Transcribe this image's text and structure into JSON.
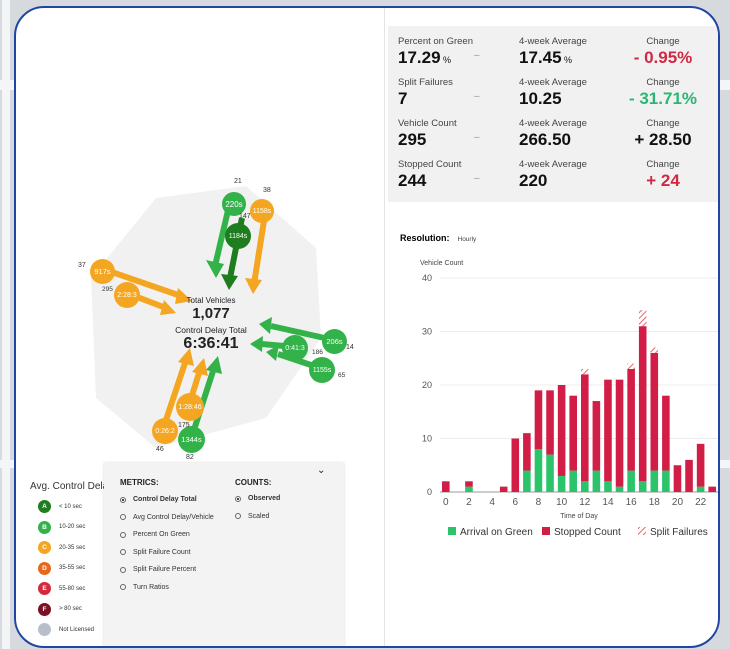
{
  "stats": [
    {
      "label": "Percent on Green",
      "value": "17.29",
      "unit": "%",
      "avg_label": "4-week Average",
      "avg_value": "17.45",
      "avg_unit": "%",
      "change_label": "Change",
      "change_value": "- 0.95%",
      "change_color": "#d02944"
    },
    {
      "label": "Split Failures",
      "value": "7",
      "unit": "",
      "avg_label": "4-week Average",
      "avg_value": "10.25",
      "avg_unit": "",
      "change_label": "Change",
      "change_value": "- 31.71%",
      "change_color": "#2bb673"
    },
    {
      "label": "Vehicle Count",
      "value": "295",
      "unit": "",
      "avg_label": "4-week Average",
      "avg_value": "266.50",
      "avg_unit": "",
      "change_label": "Change",
      "change_value": "+ 28.50",
      "change_color": "#111111"
    },
    {
      "label": "Stopped Count",
      "value": "244",
      "unit": "",
      "avg_label": "4-week Average",
      "avg_value": "220",
      "avg_unit": "",
      "change_label": "Change",
      "change_value": "+ 24",
      "change_color": "#d02944"
    }
  ],
  "dash_symbol": "–",
  "resolution": {
    "label": "Resolution:",
    "value": "Hourly"
  },
  "intersection": {
    "total_vehicles_label": "Total Vehicles",
    "total_vehicles": "1,077",
    "control_delay_label": "Control Delay Total",
    "control_delay": "6:36:41",
    "north": {
      "count_left": "21",
      "count_right": "38",
      "count_mid": "147",
      "delay_left": "220s",
      "delay_right": "1158s",
      "delay_mid": "1184s"
    },
    "west": {
      "count_top": "37",
      "count_bottom": "295",
      "delay_top": "917s",
      "delay_bottom": "2:28:3"
    },
    "east": {
      "count_top": "14",
      "count_mid": "186",
      "count_bottom": "65",
      "delay_top": "206s",
      "delay_mid": "0:41:3",
      "delay_bottom": "1155s"
    },
    "south": {
      "count_top": "175",
      "count_left": "46",
      "count_bottom": "82",
      "delay_top": "1:28:46",
      "delay_left": "0:26:2",
      "delay_bottom": "1344s"
    }
  },
  "metrics_panel": {
    "metrics_heading": "METRICS:",
    "counts_heading": "COUNTS:",
    "metrics": [
      "Control Delay Total",
      "Avg Control Delay/Vehicle",
      "Percent On Green",
      "Split Failure Count",
      "Split Failure Percent",
      "Turn Ratios"
    ],
    "metrics_selected": 0,
    "counts": [
      "Observed",
      "Scaled"
    ],
    "counts_selected": 0,
    "collapse_symbol": "⌄"
  },
  "avg_legend": {
    "title": "Avg. Control Dela",
    "items": [
      {
        "grade": "A",
        "label": "< 10 sec",
        "color": "#1e7d1e"
      },
      {
        "grade": "B",
        "label": "10-20 sec",
        "color": "#34b24a"
      },
      {
        "grade": "C",
        "label": "20-35 sec",
        "color": "#f4a622"
      },
      {
        "grade": "D",
        "label": "35-55 sec",
        "color": "#e8671f"
      },
      {
        "grade": "E",
        "label": "55-80 sec",
        "color": "#d4293d"
      },
      {
        "grade": "F",
        "label": "> 80 sec",
        "color": "#7d1024"
      },
      {
        "grade": "",
        "label": "Not Licensed",
        "color": "#b8bfca"
      }
    ]
  },
  "chart_data": {
    "type": "bar",
    "ylabel": "Vehicle Count",
    "xlabel": "Time of Day",
    "ylim": [
      0,
      40
    ],
    "yticks": [
      0,
      10,
      20,
      30,
      40
    ],
    "xticks": [
      0,
      2,
      4,
      6,
      8,
      10,
      12,
      14,
      16,
      18,
      20,
      22
    ],
    "categories": [
      0,
      1,
      2,
      3,
      4,
      5,
      6,
      7,
      8,
      9,
      10,
      11,
      12,
      13,
      14,
      15,
      16,
      17,
      18,
      19,
      20,
      21,
      22,
      23
    ],
    "series": [
      {
        "name": "Arrival on Green",
        "color": "#2bc46a",
        "values": [
          0,
          0,
          1,
          0,
          0,
          0,
          0,
          4,
          8,
          7,
          3,
          4,
          2,
          4,
          2,
          1,
          4,
          2,
          4,
          4,
          0,
          0,
          1,
          0
        ]
      },
      {
        "name": "Stopped Count",
        "color": "#d21d47",
        "values": [
          2,
          0,
          1,
          0,
          0,
          1,
          10,
          7,
          11,
          12,
          17,
          14,
          20,
          13,
          19,
          20,
          19,
          29,
          22,
          14,
          5,
          6,
          8,
          1
        ]
      },
      {
        "name": "Split Failures",
        "color": "#e8646e",
        "values": [
          0,
          0,
          0,
          0,
          0,
          0,
          0,
          0,
          0,
          0,
          0,
          0,
          1,
          0,
          0,
          0,
          1,
          3,
          1,
          0,
          0,
          0,
          0,
          0
        ]
      }
    ],
    "legend": "bottom"
  }
}
